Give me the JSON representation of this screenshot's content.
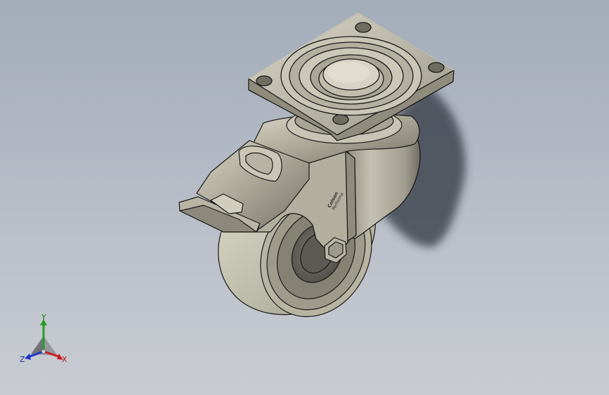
{
  "viewport": {
    "background_top": "#a3acb9",
    "background_bottom": "#c9ccd2"
  },
  "model": {
    "part_type": "swivel caster with total-lock brake",
    "material_color": "#a9a594",
    "tread_color": "#c8c6b4",
    "edge_color": "#1a1a18",
    "shadow_color": "#3a3f48",
    "embossed_text_line1": "Colson",
    "embossed_text_line2": "Performa"
  },
  "triad": {
    "x_label": "X",
    "y_label": "Y",
    "z_label": "Z",
    "x_color": "#c81e1e",
    "y_color": "#21a021",
    "z_color": "#1e34c8"
  }
}
